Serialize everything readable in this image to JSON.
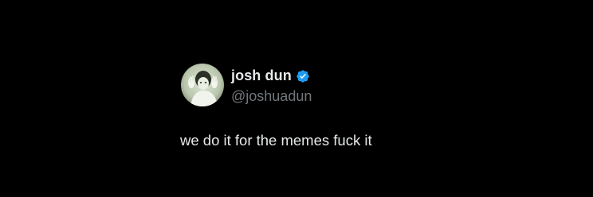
{
  "tweet": {
    "display_name": "josh dun",
    "handle": "@joshuadun",
    "verified": true,
    "text": "we do it for the memes fuck it"
  },
  "colors": {
    "background": "#000000",
    "name": "#e7e9ea",
    "handle": "#71767b",
    "verified_badge": "#1d9bf0"
  },
  "icons": {
    "verified": "verified-badge-icon",
    "avatar": "profile-avatar"
  }
}
